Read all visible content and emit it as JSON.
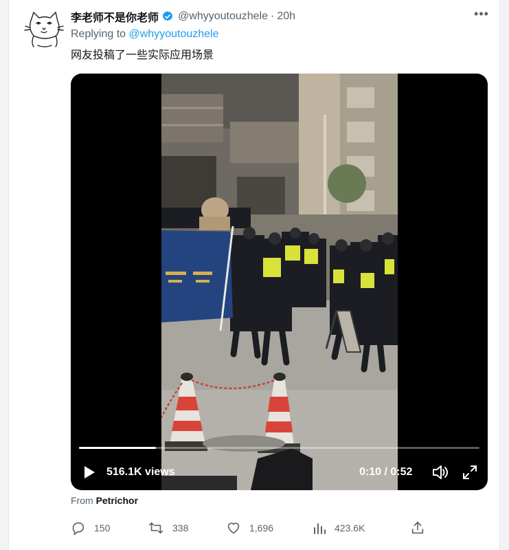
{
  "author": {
    "display_name": "李老师不是你老师",
    "handle": "@whyyoutouzhele",
    "time": "20h"
  },
  "reply_context": {
    "prefix": "Replying to",
    "handle": "@whyyoutouzhele"
  },
  "tweet_text": "网友投稿了一些实际应用场景",
  "video": {
    "views": "516.1K views",
    "time_display": "0:10 / 0:52",
    "progress": 0.192
  },
  "source": {
    "prefix": "From",
    "name": "Petrichor"
  },
  "actions": {
    "replies": "150",
    "retweets": "338",
    "likes": "1,696",
    "views": "423.6K"
  },
  "colors": {
    "link": "#1d9bf0",
    "verified": "#1d9bf0",
    "muted": "#536471"
  },
  "icons": [
    "cat-avatar",
    "verified-badge-icon",
    "more-icon",
    "play-icon",
    "volume-icon",
    "fullscreen-icon",
    "reply-icon",
    "retweet-icon",
    "like-icon",
    "views-icon",
    "share-icon"
  ]
}
